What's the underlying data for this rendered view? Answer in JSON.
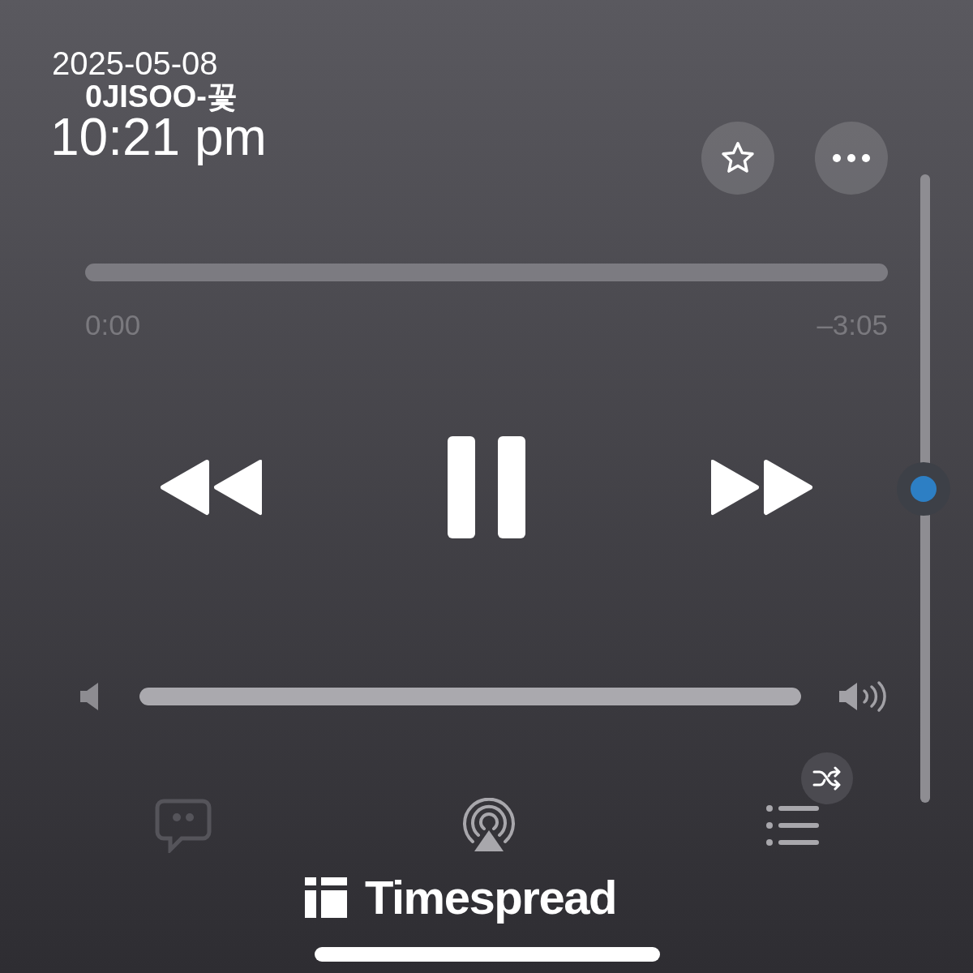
{
  "overlay": {
    "date": "2025-05-08",
    "time": "10:21 pm"
  },
  "track": {
    "title": "0JISOO-꽃"
  },
  "actions": [
    {
      "kind": "favorite",
      "favorited": false
    },
    {
      "kind": "more"
    }
  ],
  "progress": {
    "level": 0,
    "elapsed": "0:00",
    "remaining": "–3:05"
  },
  "playback": {
    "playing": true
  },
  "volume": {
    "level": 1
  },
  "bottom_buttons": [
    {
      "kind": "lyrics",
      "disabled": true
    },
    {
      "kind": "airplay",
      "disabled": false
    },
    {
      "kind": "queue",
      "disabled": false
    }
  ],
  "brand": {
    "name": "Timespread"
  }
}
